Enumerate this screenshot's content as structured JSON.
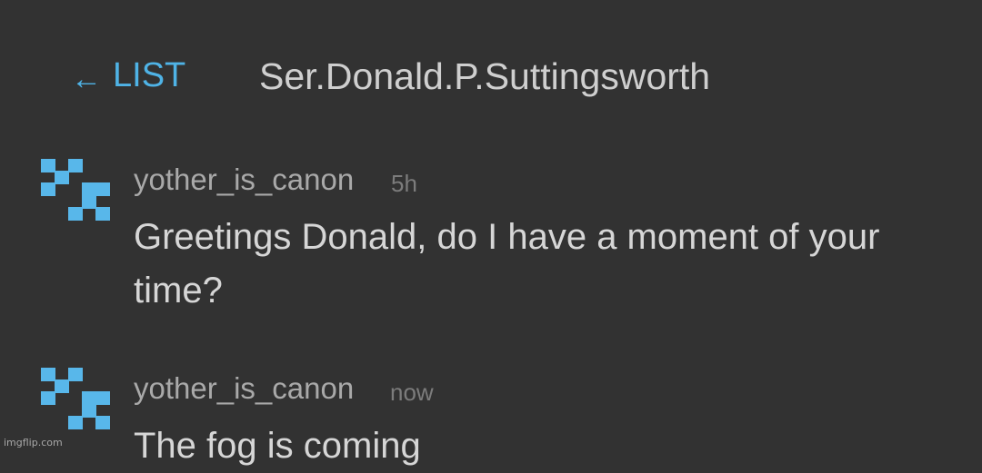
{
  "header": {
    "back_arrow": "←",
    "back_label": "LIST",
    "title": "Ser.Donald.P.Suttingsworth"
  },
  "messages": [
    {
      "username": "yother_is_canon",
      "time": "5h",
      "text": "Greetings Donald, do I have a moment of your time?",
      "avatar_icon": "pixel-identicon"
    },
    {
      "username": "yother_is_canon",
      "time": "now",
      "text": "The fog is coming",
      "avatar_icon": "pixel-identicon"
    }
  ],
  "watermark": "imgflip.com",
  "colors": {
    "background": "#323232",
    "accent": "#4fb3e6",
    "avatar": "#58b7ea",
    "text": "#d6d6d6",
    "muted": "#7c7c7c"
  }
}
